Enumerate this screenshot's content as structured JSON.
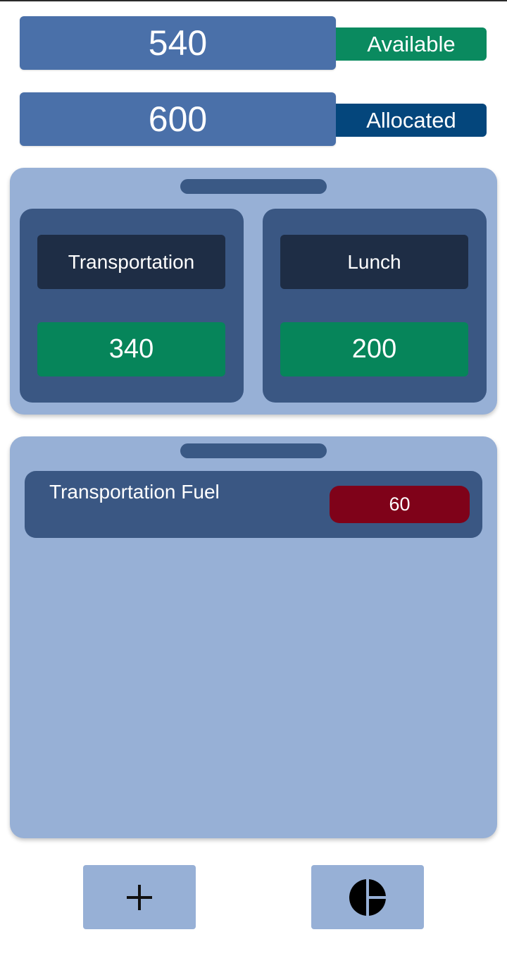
{
  "summary": {
    "available": {
      "value": "540",
      "label": "Available",
      "color": "#0a8a5f"
    },
    "allocated": {
      "value": "600",
      "label": "Allocated",
      "color": "#04467c"
    }
  },
  "categories": [
    {
      "name": "Transportation",
      "amount": "340"
    },
    {
      "name": "Lunch",
      "amount": "200"
    }
  ],
  "expenses": [
    {
      "label": "Transportation Fuel",
      "amount": "60"
    }
  ],
  "bottom_bar": [
    {
      "icon": "plus-icon"
    },
    {
      "icon": "pie-chart-icon"
    }
  ],
  "colors": {
    "primary": "#4a70a9",
    "panel": "#97b0d6",
    "card": "#3a5783",
    "label_dark": "#1e2d45",
    "positive": "#06855a",
    "negative": "#7f0219"
  }
}
